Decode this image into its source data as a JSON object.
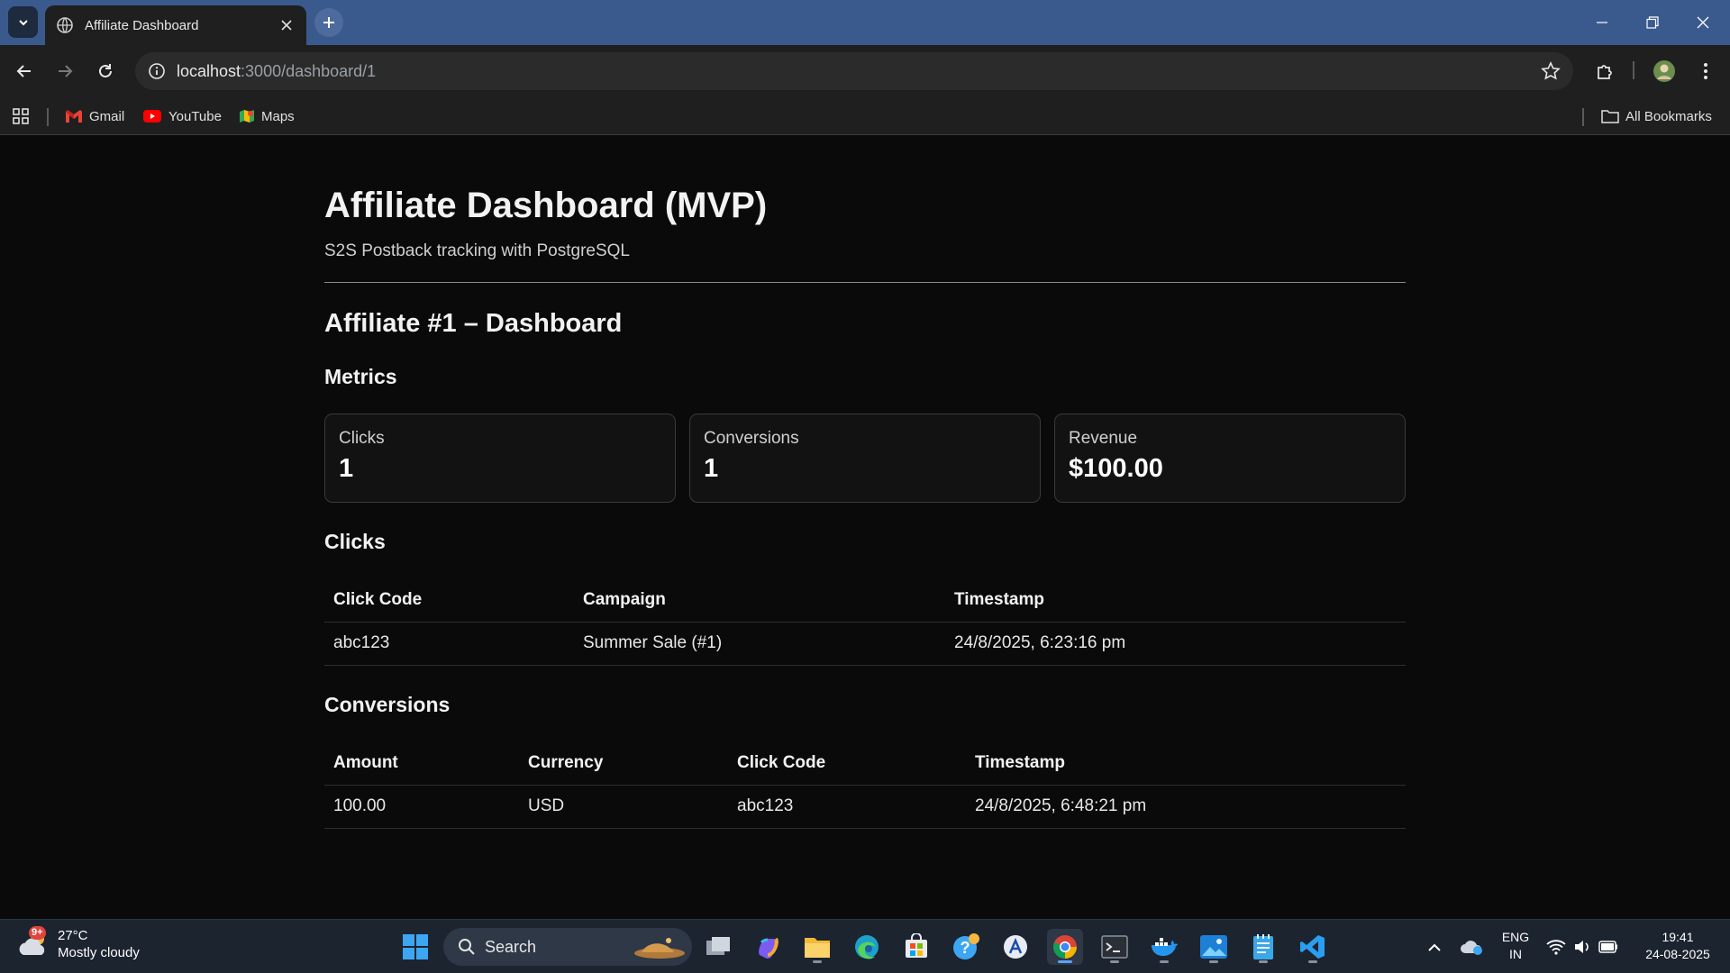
{
  "browser": {
    "tab_title": "Affiliate Dashboard",
    "url_host": "localhost",
    "url_path": ":3000/dashboard/1",
    "bookmarks": [
      {
        "label": "Gmail",
        "icon": "gmail-icon"
      },
      {
        "label": "YouTube",
        "icon": "youtube-icon"
      },
      {
        "label": "Maps",
        "icon": "maps-icon"
      }
    ],
    "all_bookmarks_label": "All Bookmarks"
  },
  "page": {
    "title": "Affiliate Dashboard (MVP)",
    "subtitle": "S2S Postback tracking with PostgreSQL",
    "section_title": "Affiliate #1 – Dashboard",
    "metrics_heading": "Metrics",
    "metrics": [
      {
        "label": "Clicks",
        "value": "1"
      },
      {
        "label": "Conversions",
        "value": "1"
      },
      {
        "label": "Revenue",
        "value": "$100.00"
      }
    ],
    "clicks_heading": "Clicks",
    "clicks_table": {
      "headers": [
        "Click Code",
        "Campaign",
        "Timestamp"
      ],
      "rows": [
        [
          "abc123",
          "Summer Sale (#1)",
          "24/8/2025, 6:23:16 pm"
        ]
      ]
    },
    "conversions_heading": "Conversions",
    "conversions_table": {
      "headers": [
        "Amount",
        "Currency",
        "Click Code",
        "Timestamp"
      ],
      "rows": [
        [
          "100.00",
          "USD",
          "abc123",
          "24/8/2025, 6:48:21 pm"
        ]
      ]
    }
  },
  "taskbar": {
    "weather_temp": "27°C",
    "weather_desc": "Mostly cloudy",
    "weather_badge": "9+",
    "search_label": "Search",
    "lang_top": "ENG",
    "lang_bottom": "IN",
    "time": "19:41",
    "date": "24-08-2025"
  },
  "colors": {
    "page_bg": "#0a0a0a",
    "tabstrip": "#3a5a8e",
    "chrome_bg": "#1f1f1f",
    "taskbar_bg": "#1c2430",
    "accent": "#5aa3ff"
  }
}
